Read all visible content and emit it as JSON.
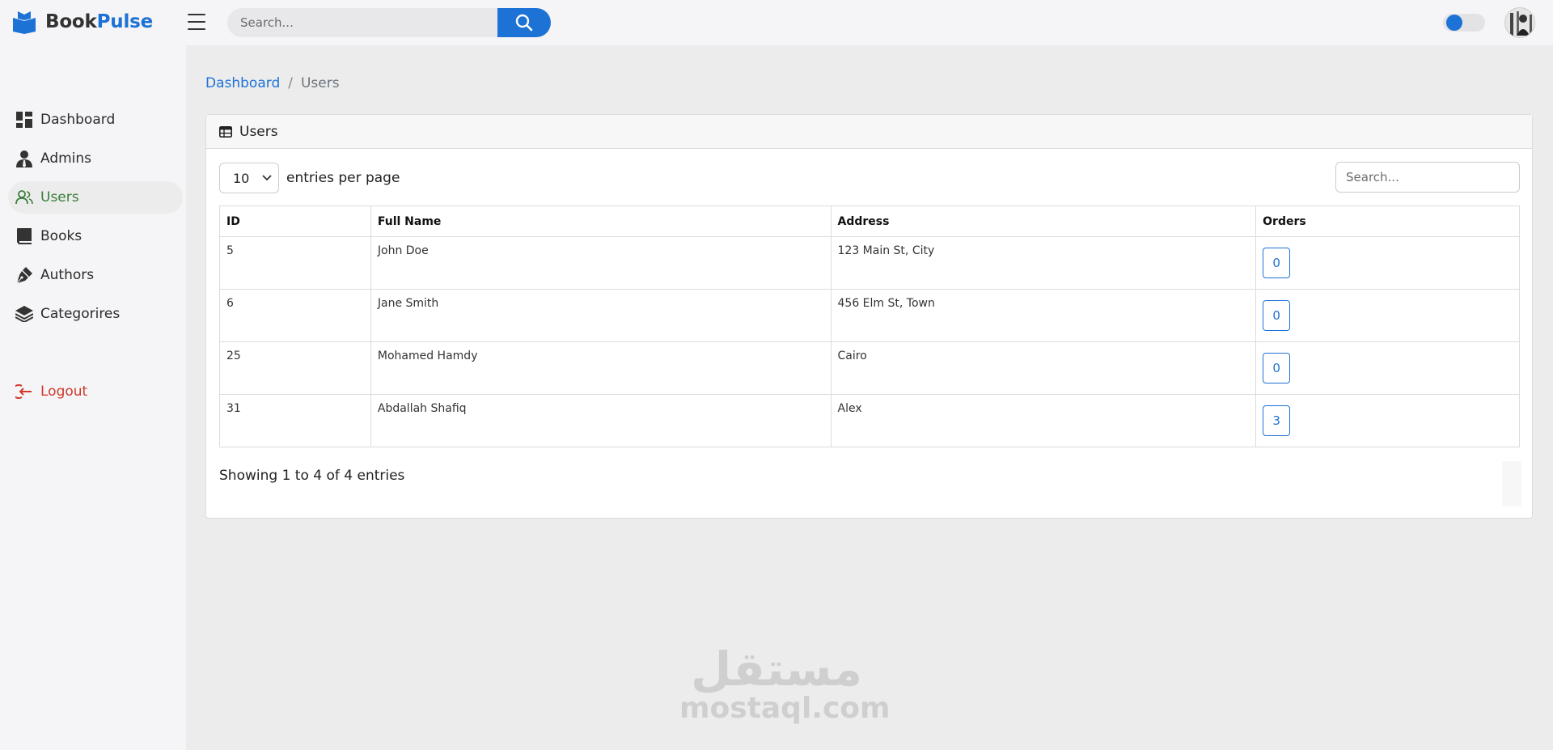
{
  "brand": {
    "name_part1": "Book",
    "name_part2": "Pulse",
    "logo_icon": "book-open-icon"
  },
  "header": {
    "search_placeholder": "Search...",
    "theme_toggle": "on"
  },
  "sidebar": {
    "items": [
      {
        "label": "Dashboard",
        "icon": "dashboard-icon"
      },
      {
        "label": "Admins",
        "icon": "user-tie-icon"
      },
      {
        "label": "Users",
        "icon": "users-icon",
        "active": true
      },
      {
        "label": "Books",
        "icon": "book-icon"
      },
      {
        "label": "Authors",
        "icon": "pen-nib-icon"
      },
      {
        "label": "Categorires",
        "icon": "layers-icon"
      }
    ],
    "logout": {
      "label": "Logout",
      "icon": "logout-icon"
    }
  },
  "breadcrumb": {
    "home": "Dashboard",
    "separator": "/",
    "current": "Users"
  },
  "card": {
    "title": "Users",
    "entries_value": "10",
    "entries_label": "entries per page",
    "search_placeholder": "Search...",
    "columns": [
      "ID",
      "Full Name",
      "Address",
      "Orders"
    ],
    "rows": [
      {
        "id": "5",
        "name": "John Doe",
        "address": "123 Main St, City",
        "orders": "0"
      },
      {
        "id": "6",
        "name": "Jane Smith",
        "address": "456 Elm St, Town",
        "orders": "0"
      },
      {
        "id": "25",
        "name": "Mohamed Hamdy",
        "address": "Cairo",
        "orders": "0"
      },
      {
        "id": "31",
        "name": "Abdallah Shafiq",
        "address": "Alex",
        "orders": "3"
      }
    ],
    "info": "Showing 1 to 4 of 4 entries"
  },
  "watermark": {
    "arabic": "مستقل",
    "latin": "mostaql.com"
  },
  "colors": {
    "accent": "#1d72d6",
    "active_nav": "#3b7d3b",
    "logout": "#d0392b"
  }
}
